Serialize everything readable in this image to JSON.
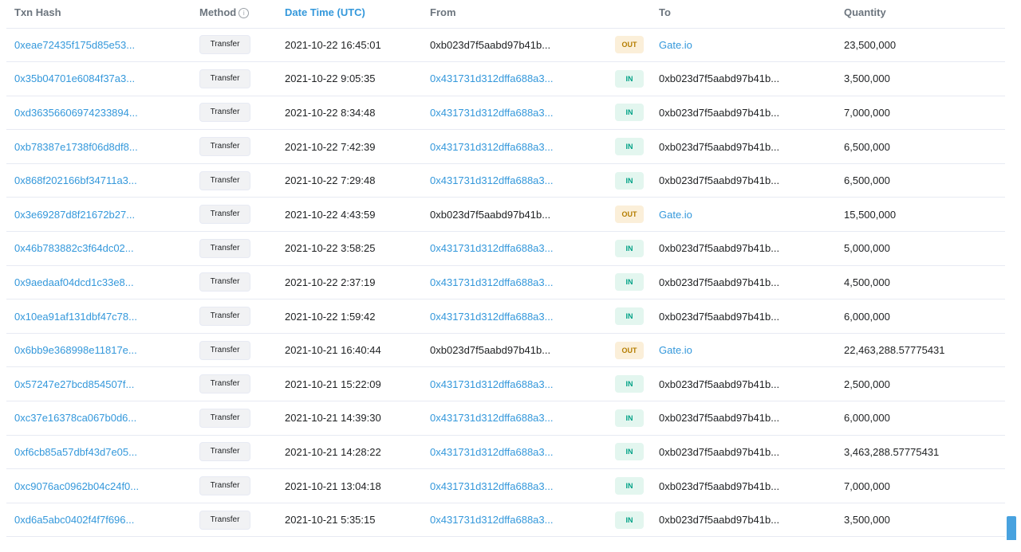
{
  "columns": {
    "txn_hash": "Txn Hash",
    "method": "Method",
    "method_info_icon": "info-icon",
    "date_time": "Date Time (UTC)",
    "from": "From",
    "to": "To",
    "quantity": "Quantity"
  },
  "colors": {
    "link": "#3498db",
    "in_badge_bg": "#e3f6ef",
    "in_badge_text": "#00a186",
    "out_badge_bg": "#fbefd9",
    "out_badge_text": "#b47d00"
  },
  "rows": [
    {
      "hash": "0xeae72435f175d85e53...",
      "method": "Transfer",
      "date": "2021-10-22 16:45:01",
      "from": "0xb023d7f5aabd97b41b...",
      "from_link": false,
      "dir": "OUT",
      "to": "Gate.io",
      "to_link": true,
      "quantity": "23,500,000"
    },
    {
      "hash": "0x35b04701e6084f37a3...",
      "method": "Transfer",
      "date": "2021-10-22 9:05:35",
      "from": "0x431731d312dffa688a3...",
      "from_link": true,
      "dir": "IN",
      "to": "0xb023d7f5aabd97b41b...",
      "to_link": false,
      "quantity": "3,500,000"
    },
    {
      "hash": "0xd36356606974233894...",
      "method": "Transfer",
      "date": "2021-10-22 8:34:48",
      "from": "0x431731d312dffa688a3...",
      "from_link": true,
      "dir": "IN",
      "to": "0xb023d7f5aabd97b41b...",
      "to_link": false,
      "quantity": "7,000,000"
    },
    {
      "hash": "0xb78387e1738f06d8df8...",
      "method": "Transfer",
      "date": "2021-10-22 7:42:39",
      "from": "0x431731d312dffa688a3...",
      "from_link": true,
      "dir": "IN",
      "to": "0xb023d7f5aabd97b41b...",
      "to_link": false,
      "quantity": "6,500,000"
    },
    {
      "hash": "0x868f202166bf34711a3...",
      "method": "Transfer",
      "date": "2021-10-22 7:29:48",
      "from": "0x431731d312dffa688a3...",
      "from_link": true,
      "dir": "IN",
      "to": "0xb023d7f5aabd97b41b...",
      "to_link": false,
      "quantity": "6,500,000"
    },
    {
      "hash": "0x3e69287d8f21672b27...",
      "method": "Transfer",
      "date": "2021-10-22 4:43:59",
      "from": "0xb023d7f5aabd97b41b...",
      "from_link": false,
      "dir": "OUT",
      "to": "Gate.io",
      "to_link": true,
      "quantity": "15,500,000"
    },
    {
      "hash": "0x46b783882c3f64dc02...",
      "method": "Transfer",
      "date": "2021-10-22 3:58:25",
      "from": "0x431731d312dffa688a3...",
      "from_link": true,
      "dir": "IN",
      "to": "0xb023d7f5aabd97b41b...",
      "to_link": false,
      "quantity": "5,000,000"
    },
    {
      "hash": "0x9aedaaf04dcd1c33e8...",
      "method": "Transfer",
      "date": "2021-10-22 2:37:19",
      "from": "0x431731d312dffa688a3...",
      "from_link": true,
      "dir": "IN",
      "to": "0xb023d7f5aabd97b41b...",
      "to_link": false,
      "quantity": "4,500,000"
    },
    {
      "hash": "0x10ea91af131dbf47c78...",
      "method": "Transfer",
      "date": "2021-10-22 1:59:42",
      "from": "0x431731d312dffa688a3...",
      "from_link": true,
      "dir": "IN",
      "to": "0xb023d7f5aabd97b41b...",
      "to_link": false,
      "quantity": "6,000,000"
    },
    {
      "hash": "0x6bb9e368998e11817e...",
      "method": "Transfer",
      "date": "2021-10-21 16:40:44",
      "from": "0xb023d7f5aabd97b41b...",
      "from_link": false,
      "dir": "OUT",
      "to": "Gate.io",
      "to_link": true,
      "quantity": "22,463,288.57775431"
    },
    {
      "hash": "0x57247e27bcd854507f...",
      "method": "Transfer",
      "date": "2021-10-21 15:22:09",
      "from": "0x431731d312dffa688a3...",
      "from_link": true,
      "dir": "IN",
      "to": "0xb023d7f5aabd97b41b...",
      "to_link": false,
      "quantity": "2,500,000"
    },
    {
      "hash": "0xc37e16378ca067b0d6...",
      "method": "Transfer",
      "date": "2021-10-21 14:39:30",
      "from": "0x431731d312dffa688a3...",
      "from_link": true,
      "dir": "IN",
      "to": "0xb023d7f5aabd97b41b...",
      "to_link": false,
      "quantity": "6,000,000"
    },
    {
      "hash": "0xf6cb85a57dbf43d7e05...",
      "method": "Transfer",
      "date": "2021-10-21 14:28:22",
      "from": "0x431731d312dffa688a3...",
      "from_link": true,
      "dir": "IN",
      "to": "0xb023d7f5aabd97b41b...",
      "to_link": false,
      "quantity": "3,463,288.57775431"
    },
    {
      "hash": "0xc9076ac0962b04c24f0...",
      "method": "Transfer",
      "date": "2021-10-21 13:04:18",
      "from": "0x431731d312dffa688a3...",
      "from_link": true,
      "dir": "IN",
      "to": "0xb023d7f5aabd97b41b...",
      "to_link": false,
      "quantity": "7,000,000"
    },
    {
      "hash": "0xd6a5abc0402f4f7f696...",
      "method": "Transfer",
      "date": "2021-10-21 5:35:15",
      "from": "0x431731d312dffa688a3...",
      "from_link": true,
      "dir": "IN",
      "to": "0xb023d7f5aabd97b41b...",
      "to_link": false,
      "quantity": "3,500,000"
    }
  ]
}
